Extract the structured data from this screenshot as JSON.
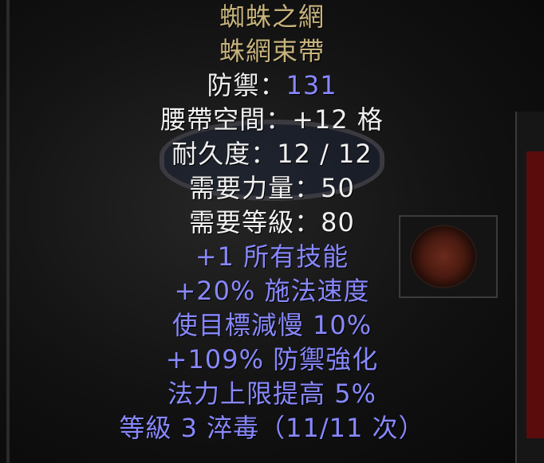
{
  "item": {
    "name": "蜘蛛之網",
    "base_type": "蛛網束帶",
    "defense_label": "防禦：",
    "defense_value": "131",
    "stats_white": [
      "腰帶空間：+12 格",
      "耐久度：12 / 12",
      "需要力量：50",
      "需要等級：80"
    ],
    "magic_properties": [
      "+1 所有技能",
      "+20% 施法速度",
      "使目標減慢 10%",
      "+109% 防禦強化",
      "法力上限提高 5%",
      "等級 3 淬毒（11/11 次）"
    ]
  },
  "colors": {
    "unique_name": "#c7b37c",
    "base_stat": "#f0f0f0",
    "magic": "#8888ff"
  }
}
